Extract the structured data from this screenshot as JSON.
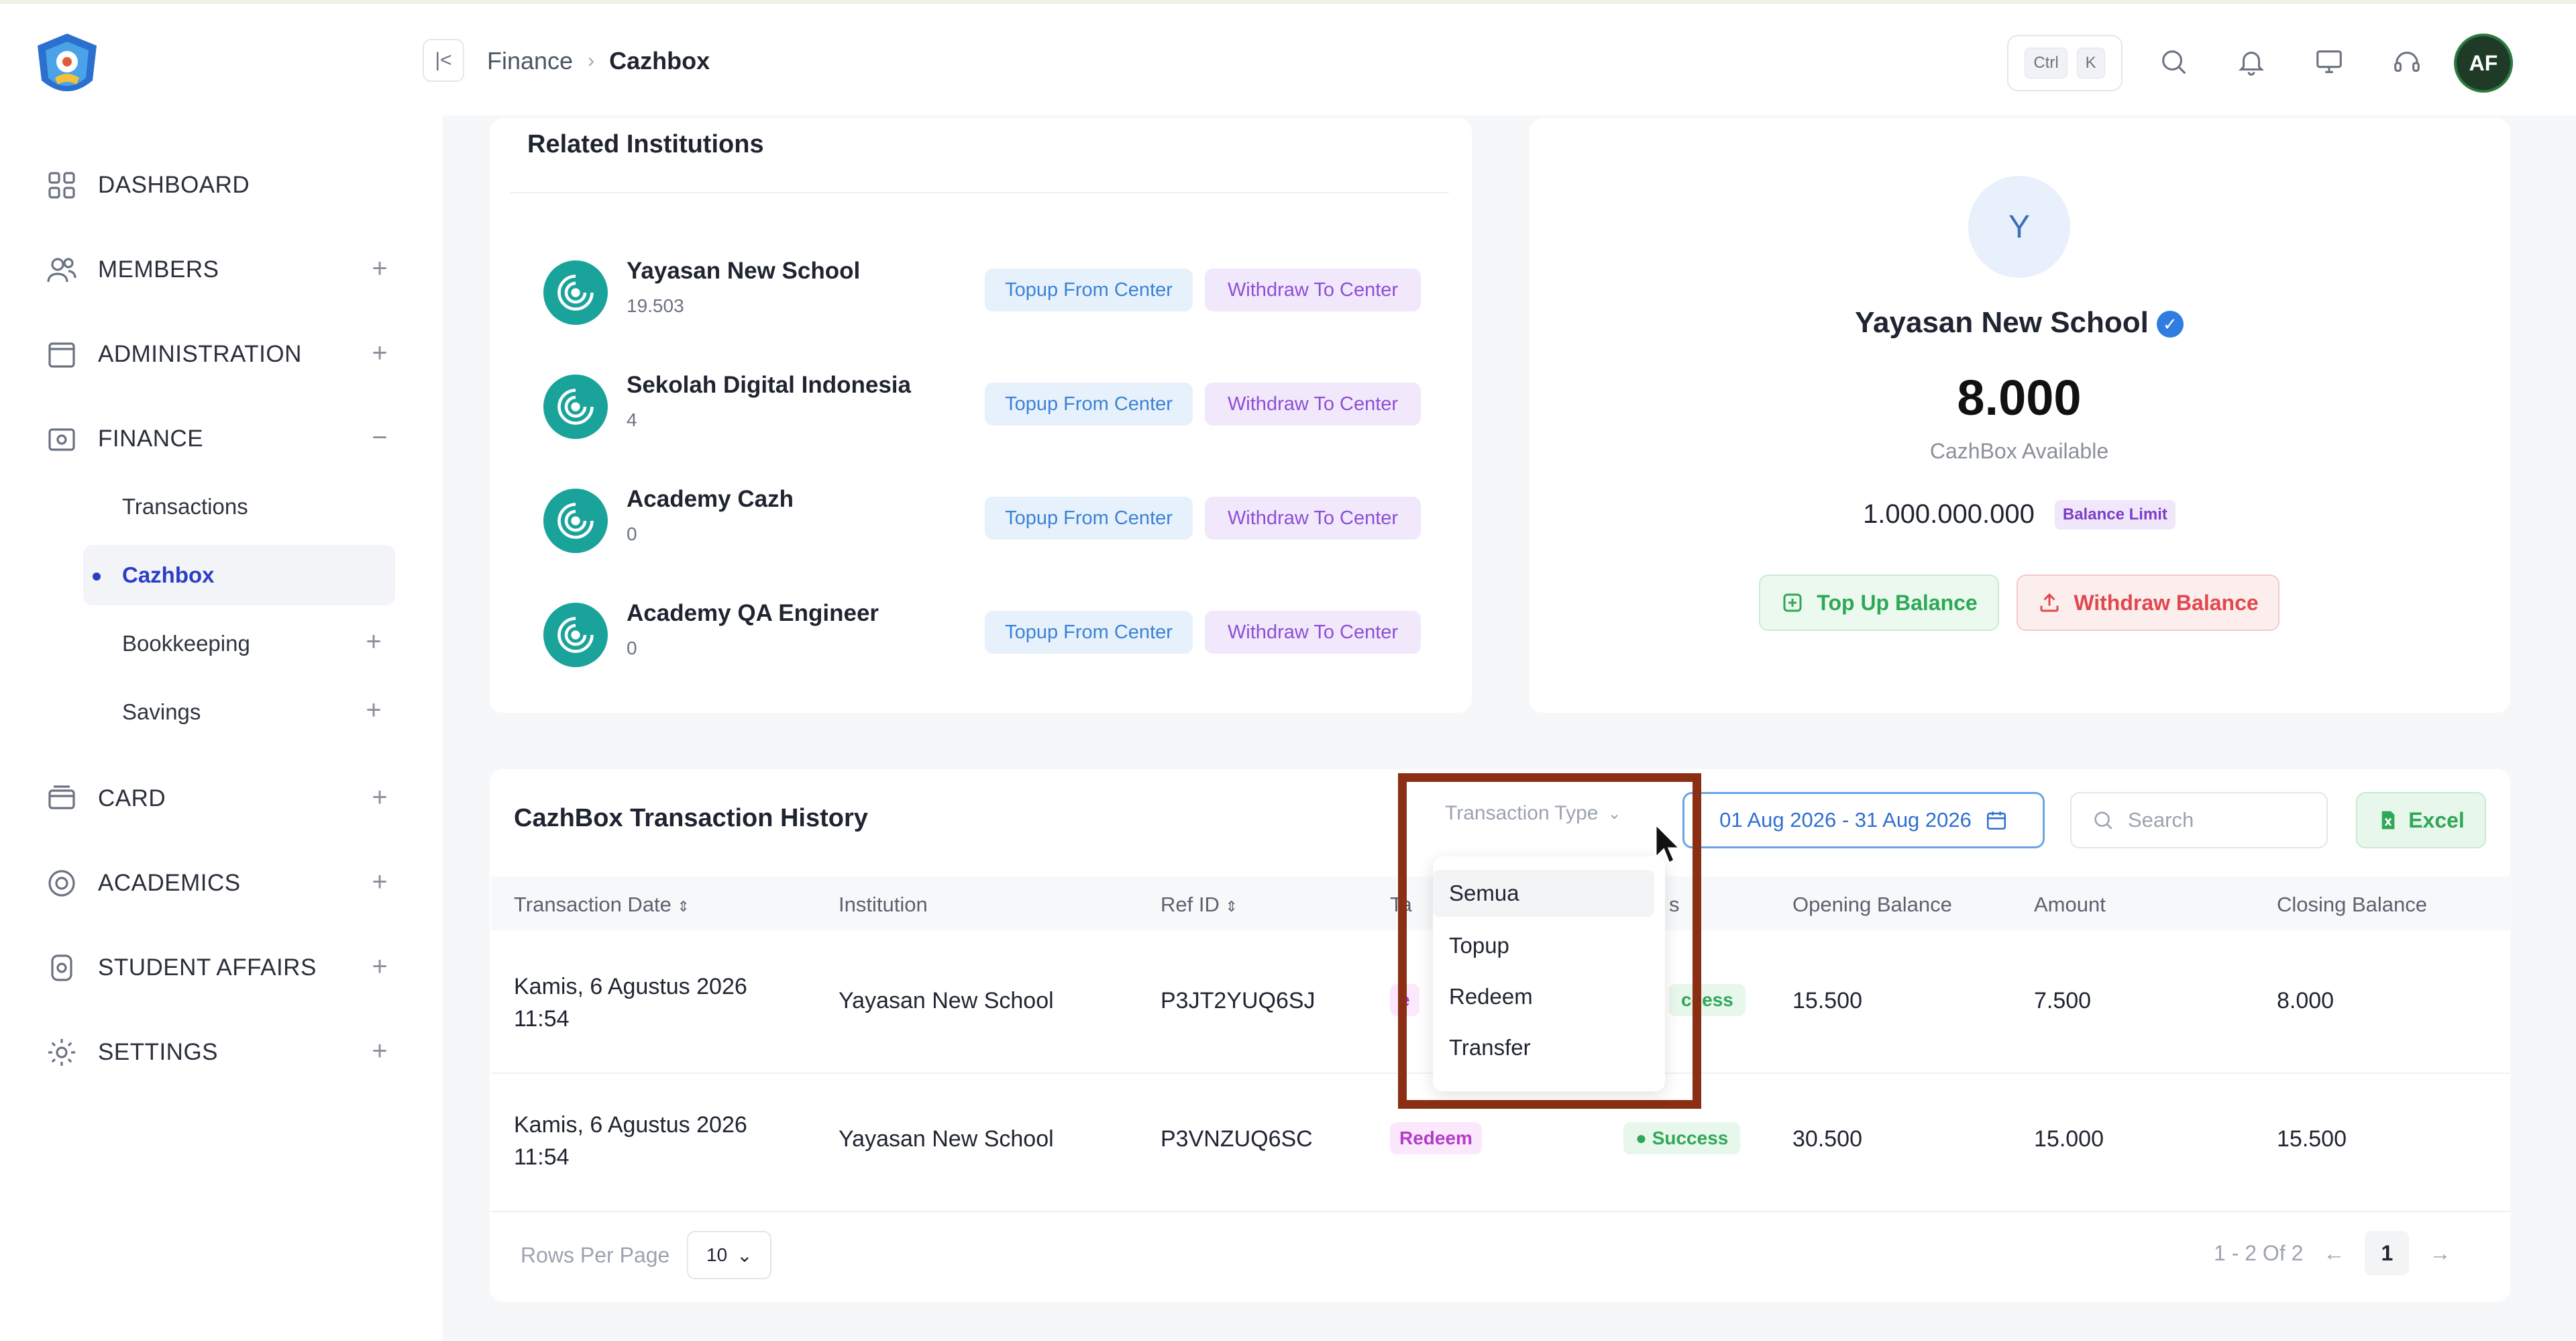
{
  "breadcrumb": {
    "parent": "Finance",
    "current": "Cazhbox"
  },
  "topbar": {
    "kbd_ctrl": "Ctrl",
    "kbd_k": "K",
    "avatar_initials": "AF"
  },
  "sidebar": {
    "items": [
      {
        "label": "DASHBOARD",
        "icon": "grid-icon"
      },
      {
        "label": "MEMBERS",
        "icon": "users-icon",
        "toggle": "+"
      },
      {
        "label": "ADMINISTRATION",
        "icon": "folder-icon",
        "toggle": "+"
      },
      {
        "label": "FINANCE",
        "icon": "wallet-icon",
        "toggle": "−"
      },
      {
        "label": "CARD",
        "icon": "card-icon",
        "toggle": "+"
      },
      {
        "label": "ACADEMICS",
        "icon": "academics-icon",
        "toggle": "+"
      },
      {
        "label": "STUDENT AFFAIRS",
        "icon": "student-icon",
        "toggle": "+"
      },
      {
        "label": "SETTINGS",
        "icon": "gear-icon",
        "toggle": "+"
      }
    ],
    "finance_sub": [
      {
        "label": "Transactions"
      },
      {
        "label": "Cazhbox"
      },
      {
        "label": "Bookkeeping",
        "toggle": "+"
      },
      {
        "label": "Savings",
        "toggle": "+"
      }
    ]
  },
  "related": {
    "title": "Related Institutions",
    "topup_label": "Topup From Center",
    "withdraw_label": "Withdraw To Center",
    "items": [
      {
        "name": "Yayasan New School",
        "value": "19.503"
      },
      {
        "name": "Sekolah Digital Indonesia",
        "value": "4"
      },
      {
        "name": "Academy Cazh",
        "value": "0"
      },
      {
        "name": "Academy QA Engineer",
        "value": "0"
      }
    ]
  },
  "balance": {
    "initial": "Y",
    "name": "Yayasan New School",
    "amount": "8.000",
    "amount_label": "CazhBox Available",
    "limit": "1.000.000.000",
    "limit_label": "Balance Limit",
    "topup_btn": "Top Up Balance",
    "withdraw_btn": "Withdraw Balance"
  },
  "history": {
    "title": "CazhBox Transaction History",
    "filter_placeholder": "Transaction Type",
    "date_range": "01 Aug 2026 - 31 Aug 2026",
    "search_placeholder": "Search",
    "excel_label": "Excel",
    "columns": [
      "Transaction Date",
      "Institution",
      "Ref ID",
      "Ta",
      "s",
      "Opening Balance",
      "Amount",
      "Closing Balance"
    ],
    "rows": [
      {
        "date1": "Kamis, 6 Agustus 2026",
        "date2": "11:54",
        "institution": "Yayasan New School",
        "ref": "P3JT2YUQ6SJ",
        "type": "e",
        "status": "ccess",
        "opening": "15.500",
        "amount": "7.500",
        "closing": "8.000"
      },
      {
        "date1": "Kamis, 6 Agustus 2026",
        "date2": "11:54",
        "institution": "Yayasan New School",
        "ref": "P3VNZUQ6SC",
        "type": "Redeem",
        "status": "Success",
        "opening": "30.500",
        "amount": "15.000",
        "closing": "15.500"
      }
    ],
    "rows_per_page_label": "Rows Per Page",
    "rows_per_page": "10",
    "range_text": "1 - 2 Of 2",
    "page": "1"
  },
  "dropdown": {
    "options": [
      "Semua",
      "Topup",
      "Redeem",
      "Transfer"
    ]
  }
}
